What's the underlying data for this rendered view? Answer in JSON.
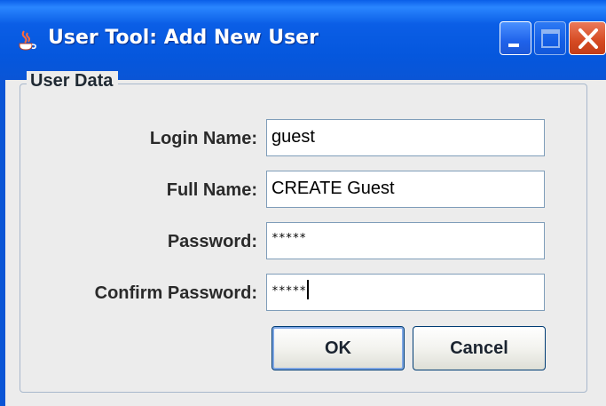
{
  "window": {
    "title": "User Tool: Add New User",
    "icon": "java-coffee-cup-icon",
    "controls": [
      "minimize-icon",
      "maximize-icon",
      "close-icon"
    ]
  },
  "group": {
    "title": "User Data"
  },
  "form": {
    "login_label": "Login Name:",
    "login_value": "guest",
    "fullname_label": "Full Name:",
    "fullname_value": "CREATE Guest",
    "password_label": "Password:",
    "password_value": "*****",
    "confirm_label": "Confirm Password:",
    "confirm_value": "*****"
  },
  "buttons": {
    "ok_label": "OK",
    "cancel_label": "Cancel"
  },
  "colors": {
    "titlebar": "#0b5ee6",
    "close_button": "#d54a22",
    "field_border": "#7f9db9",
    "background": "#ececec"
  }
}
